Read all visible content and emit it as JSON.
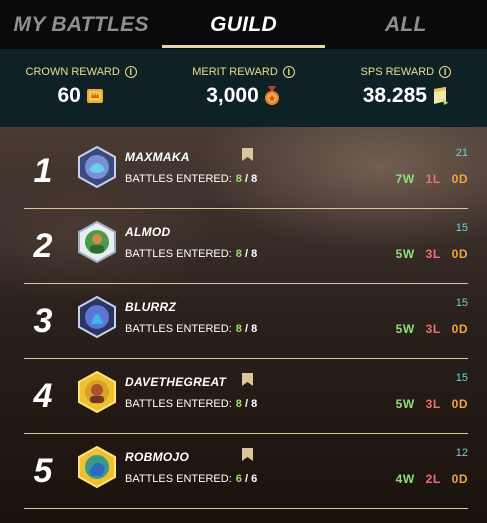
{
  "tabs": [
    {
      "label": "MY BATTLES",
      "active": false
    },
    {
      "label": "GUILD",
      "active": true
    },
    {
      "label": "ALL",
      "active": false
    }
  ],
  "rewards": [
    {
      "label": "CROWN REWARD",
      "value": "60",
      "icon": "crown-token-icon"
    },
    {
      "label": "MERIT REWARD",
      "value": "3,000",
      "icon": "merit-medal-icon"
    },
    {
      "label": "SPS REWARD",
      "value": "38.285",
      "icon": "sps-scroll-icon"
    }
  ],
  "players": [
    {
      "rank": "1",
      "name": "MAXMAKA",
      "battles_label": "BATTLES ENTERED:",
      "entered": "8",
      "total": "8",
      "score": "21",
      "wins": "7W",
      "losses": "1L",
      "draws": "0D",
      "bookmarked": true,
      "avatar_color": "#7a8fd6"
    },
    {
      "rank": "2",
      "name": "ALMOD",
      "battles_label": "BATTLES ENTERED:",
      "entered": "8",
      "total": "8",
      "score": "15",
      "wins": "5W",
      "losses": "3L",
      "draws": "0D",
      "bookmarked": false,
      "avatar_color": "#4e9a4a"
    },
    {
      "rank": "3",
      "name": "BLURRZ",
      "battles_label": "BATTLES ENTERED:",
      "entered": "8",
      "total": "8",
      "score": "15",
      "wins": "5W",
      "losses": "3L",
      "draws": "0D",
      "bookmarked": false,
      "avatar_color": "#5d74d8"
    },
    {
      "rank": "4",
      "name": "DAVETHEGREAT",
      "battles_label": "BATTLES ENTERED:",
      "entered": "8",
      "total": "8",
      "score": "15",
      "wins": "5W",
      "losses": "3L",
      "draws": "0D",
      "bookmarked": true,
      "avatar_color": "#d9a02a"
    },
    {
      "rank": "5",
      "name": "ROBMOJO",
      "battles_label": "BATTLES ENTERED:",
      "entered": "6",
      "total": "6",
      "score": "12",
      "wins": "4W",
      "losses": "2L",
      "draws": "0D",
      "bookmarked": true,
      "avatar_color": "#d9a02a"
    }
  ]
}
